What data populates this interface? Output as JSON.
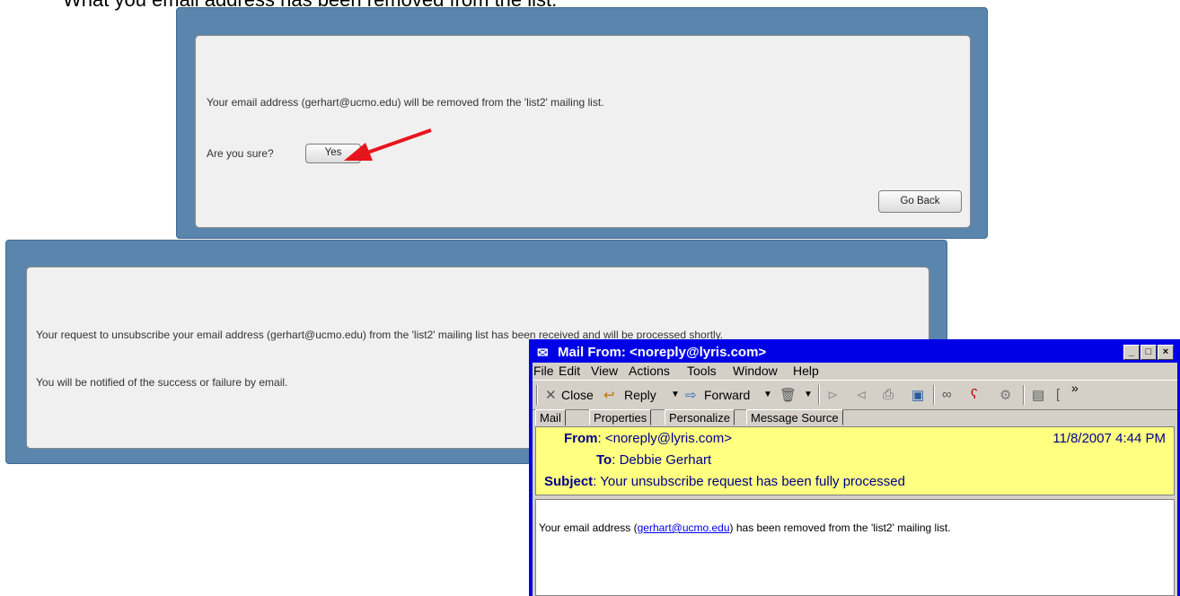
{
  "caption": "What you email address has been removed from the list.",
  "dialog1": {
    "message": "Your email address (gerhart@ucmo.edu) will be removed from the 'list2' mailing list.",
    "question": "Are you sure?",
    "yes_label": "Yes",
    "goback_label": "Go Back",
    "arrow_color": "#e8141c"
  },
  "dialog2": {
    "message1": "Your request to unsubscribe your email address (gerhart@ucmo.edu) from the 'list2' mailing list has been received and will be processed shortly.",
    "message2": "You will be notified of the success or failure by email."
  },
  "mail": {
    "title": "Mail From: <noreply@lyris.com>",
    "menu": [
      "File",
      "Edit",
      "View",
      "Actions",
      "Tools",
      "Window",
      "Help"
    ],
    "toolbar": {
      "close": "Close",
      "reply": "Reply",
      "forward": "Forward",
      "more": "»"
    },
    "tabs": [
      "Mail",
      "Properties",
      "Personalize",
      "Message Source"
    ],
    "from_label": "From",
    "from_value": "<noreply@lyris.com>",
    "date": "11/8/2007 4:44 PM",
    "to_label": "To",
    "to_value": "Debbie Gerhart",
    "subject_label": "Subject",
    "subject_value": "Your unsubscribe request has been fully processed",
    "body_prefix": "Your email address (",
    "body_link": "gerhart@ucmo.edu",
    "body_suffix": ") has been removed from the 'list2' mailing list."
  }
}
